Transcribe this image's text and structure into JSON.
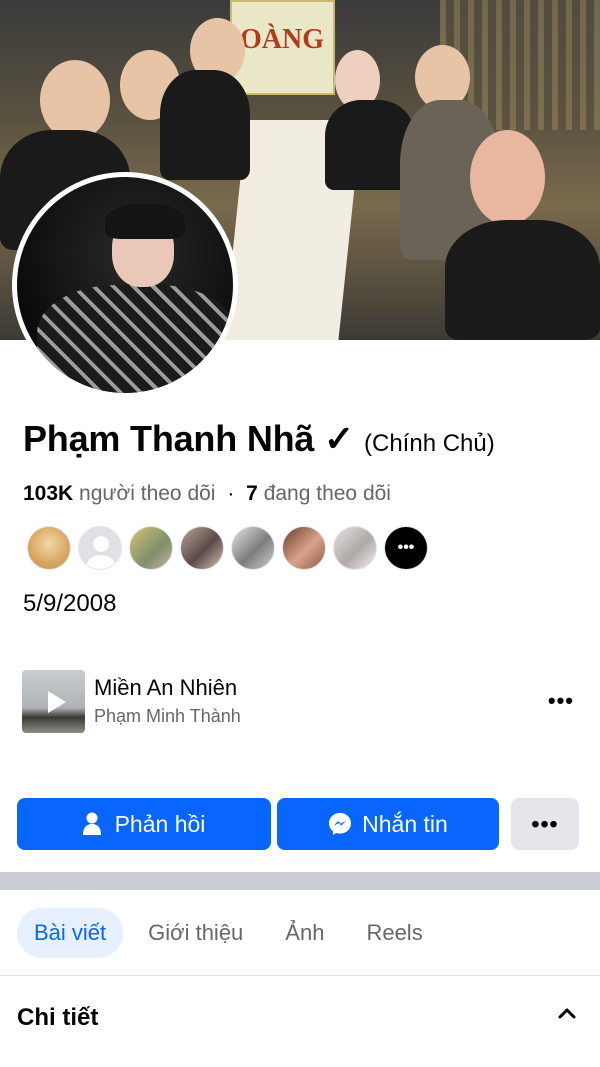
{
  "profile": {
    "name": "Phạm Thanh Nhã ✓",
    "name_suffix": "(Chính Chủ)",
    "followers_count": "103K",
    "followers_label": "người theo dõi",
    "separator": "·",
    "following_count": "7",
    "following_label": "đang theo dõi",
    "birthday": "5/9/2008"
  },
  "cover_sign_text": "OÀNG",
  "friends_more_label": "•••",
  "music": {
    "song": "Miền An Nhiên",
    "artist": "Phạm Minh Thành",
    "more_label": "•••"
  },
  "actions": {
    "reply_label": "Phản hồi",
    "message_label": "Nhắn tin",
    "more_label": "•••"
  },
  "tabs": [
    {
      "label": "Bài viết",
      "active": true
    },
    {
      "label": "Giới thiệu",
      "active": false
    },
    {
      "label": "Ảnh",
      "active": false
    },
    {
      "label": "Reels",
      "active": false
    }
  ],
  "details_section": {
    "title": "Chi tiết"
  },
  "colors": {
    "accent": "#0866ff",
    "secondary_bg": "#e4e6eb",
    "muted_text": "#65676b"
  },
  "icons": {
    "reply": "person-icon",
    "message": "messenger-icon",
    "collapse": "chevron-up-icon",
    "play": "play-icon"
  }
}
